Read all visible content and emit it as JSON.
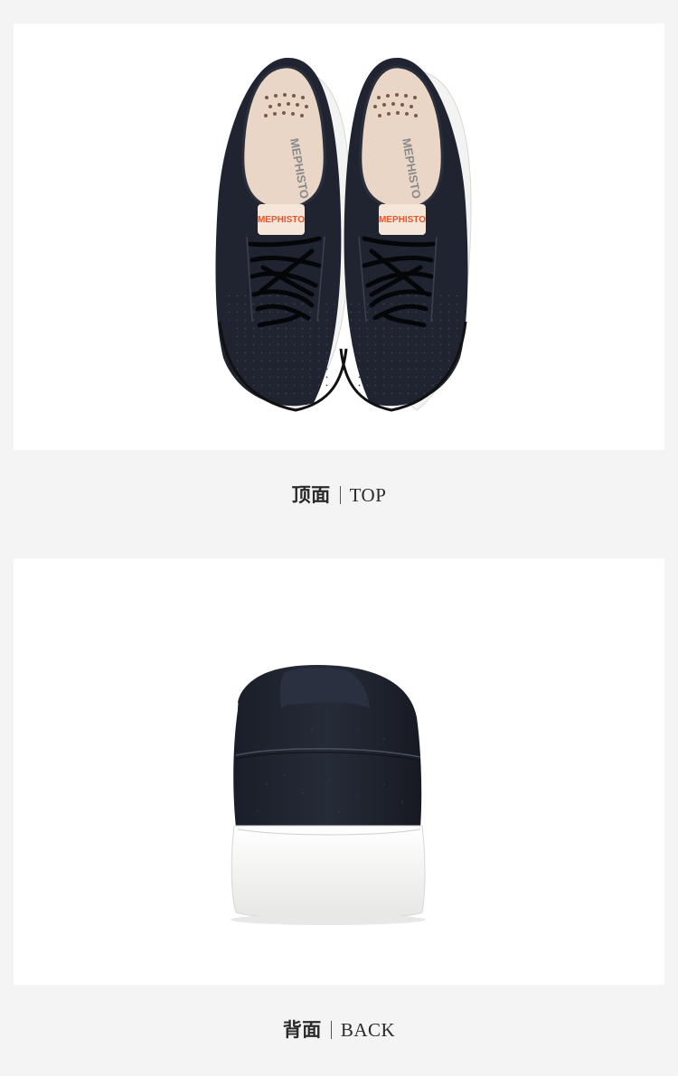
{
  "sections": [
    {
      "caption_cn": "顶面",
      "caption_en": "TOP",
      "insole_brand": "MEPHISTO",
      "tag_brand": "MEPHISTO"
    },
    {
      "caption_cn": "背面",
      "caption_en": "BACK"
    }
  ],
  "colors": {
    "page_background": "#f4f4f4",
    "panel_background": "#ffffff",
    "leather": "#1f2430",
    "sole": "#f3f3f1",
    "insole": "#e9d6c6",
    "tag_accent": "#e2572b"
  }
}
